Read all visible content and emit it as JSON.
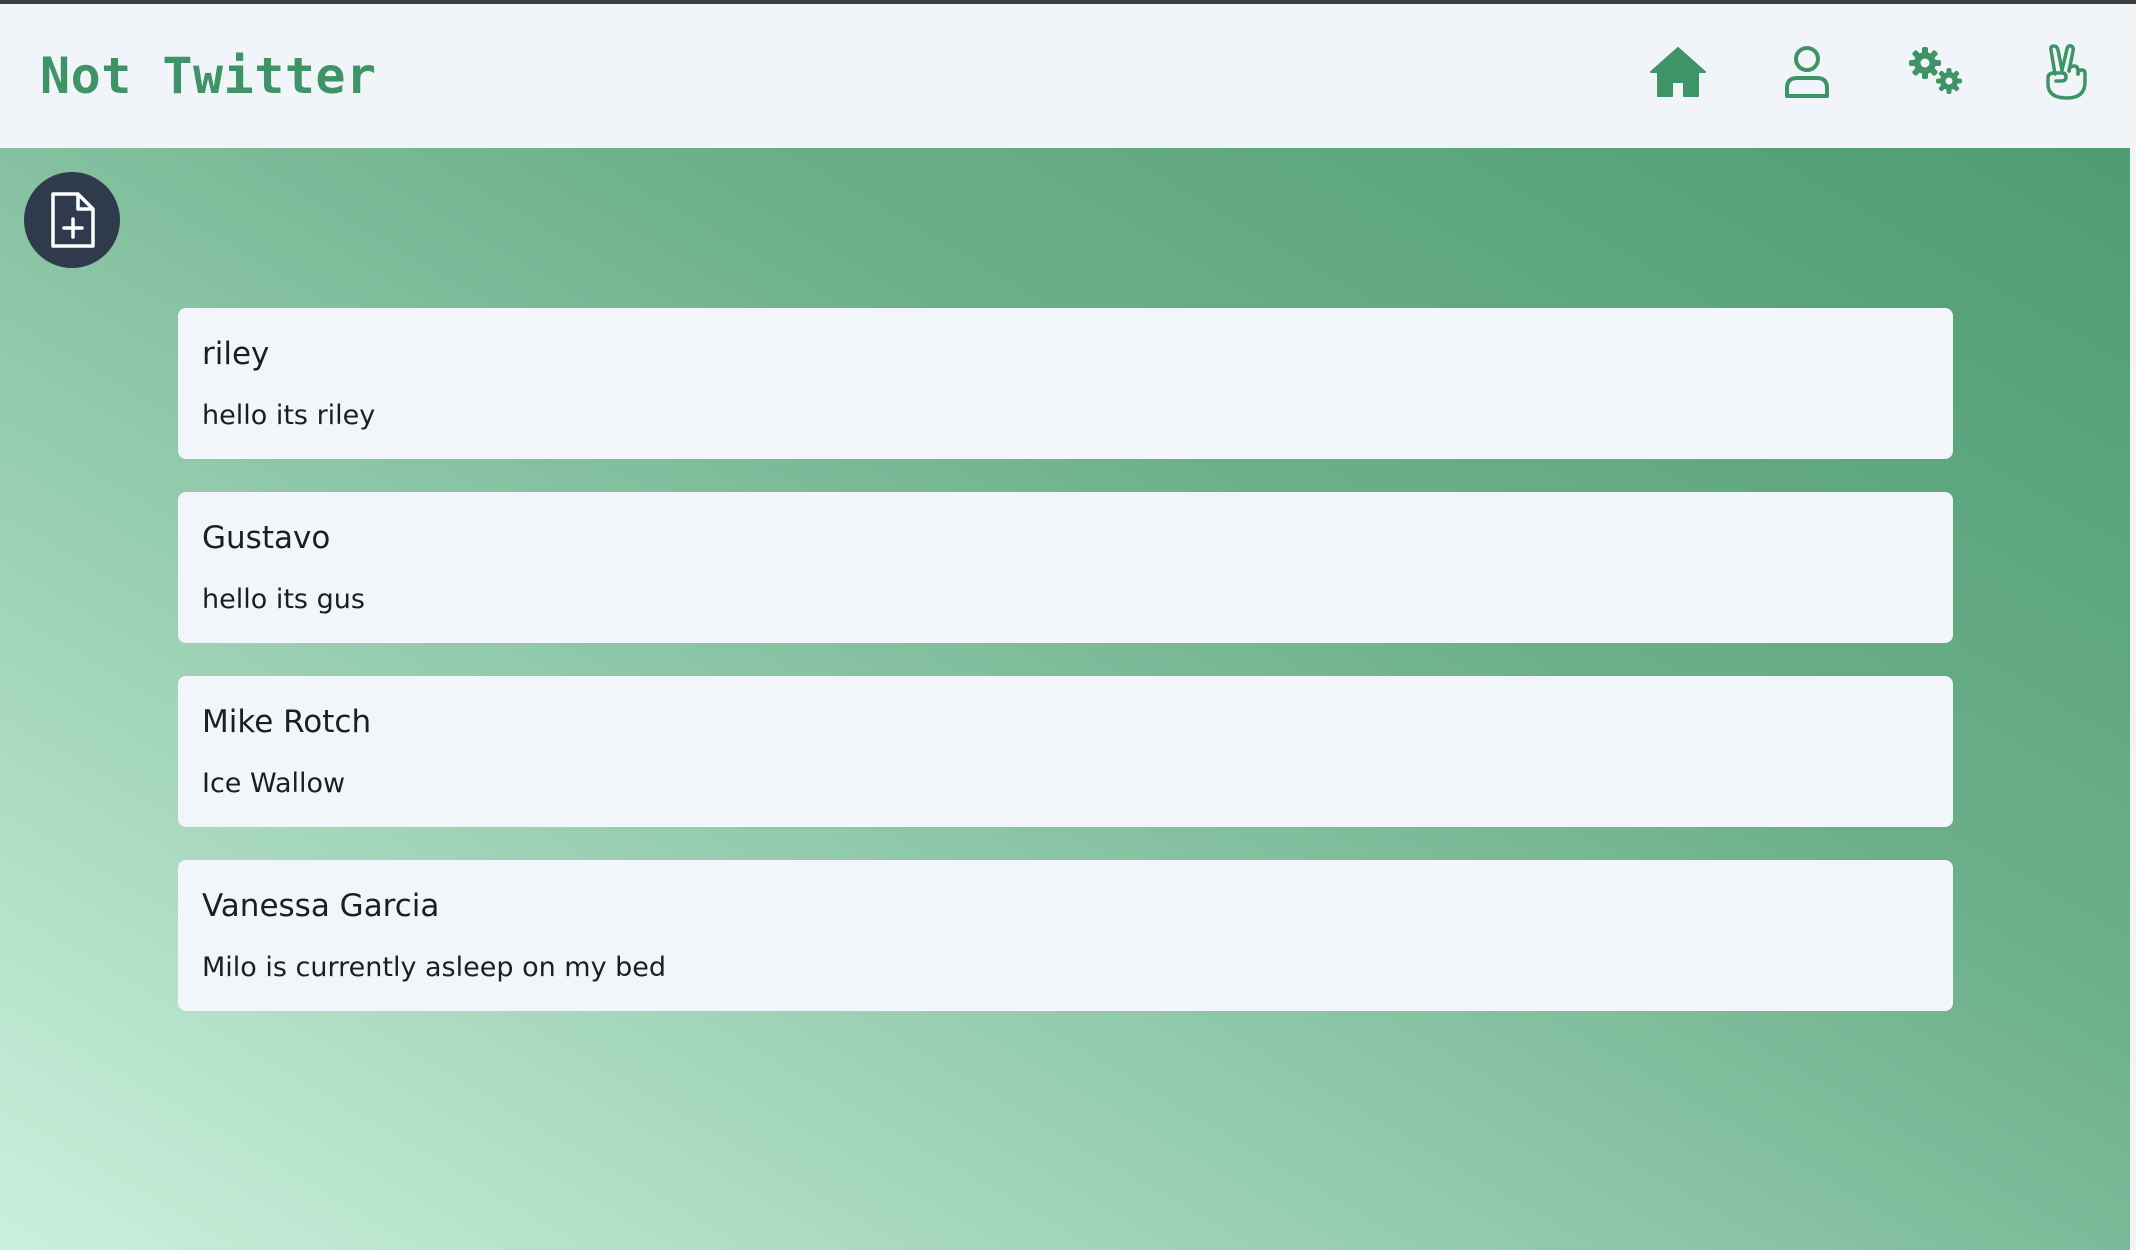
{
  "app": {
    "brand": "Not Twitter"
  },
  "nav": {
    "items": [
      {
        "name": "home",
        "icon": "home-icon"
      },
      {
        "name": "profile",
        "icon": "user-icon"
      },
      {
        "name": "settings",
        "icon": "gears-icon"
      },
      {
        "name": "logout",
        "icon": "peace-hand-icon"
      }
    ]
  },
  "compose": {
    "icon": "file-plus-icon"
  },
  "posts": [
    {
      "author": "riley",
      "text": "hello its riley"
    },
    {
      "author": "Gustavo",
      "text": "hello its gus"
    },
    {
      "author": "Mike Rotch",
      "text": "Ice Wallow"
    },
    {
      "author": "Vanessa Garcia",
      "text": "Milo is currently asleep on my bed"
    }
  ],
  "colors": {
    "brand": "#3f9467",
    "header_bg": "#f1f5fa",
    "fab_bg": "#2f3a4c",
    "card_bg": "#f2f5fa",
    "gradient_light": "#caf0dd",
    "gradient_dark": "#4a996e"
  }
}
